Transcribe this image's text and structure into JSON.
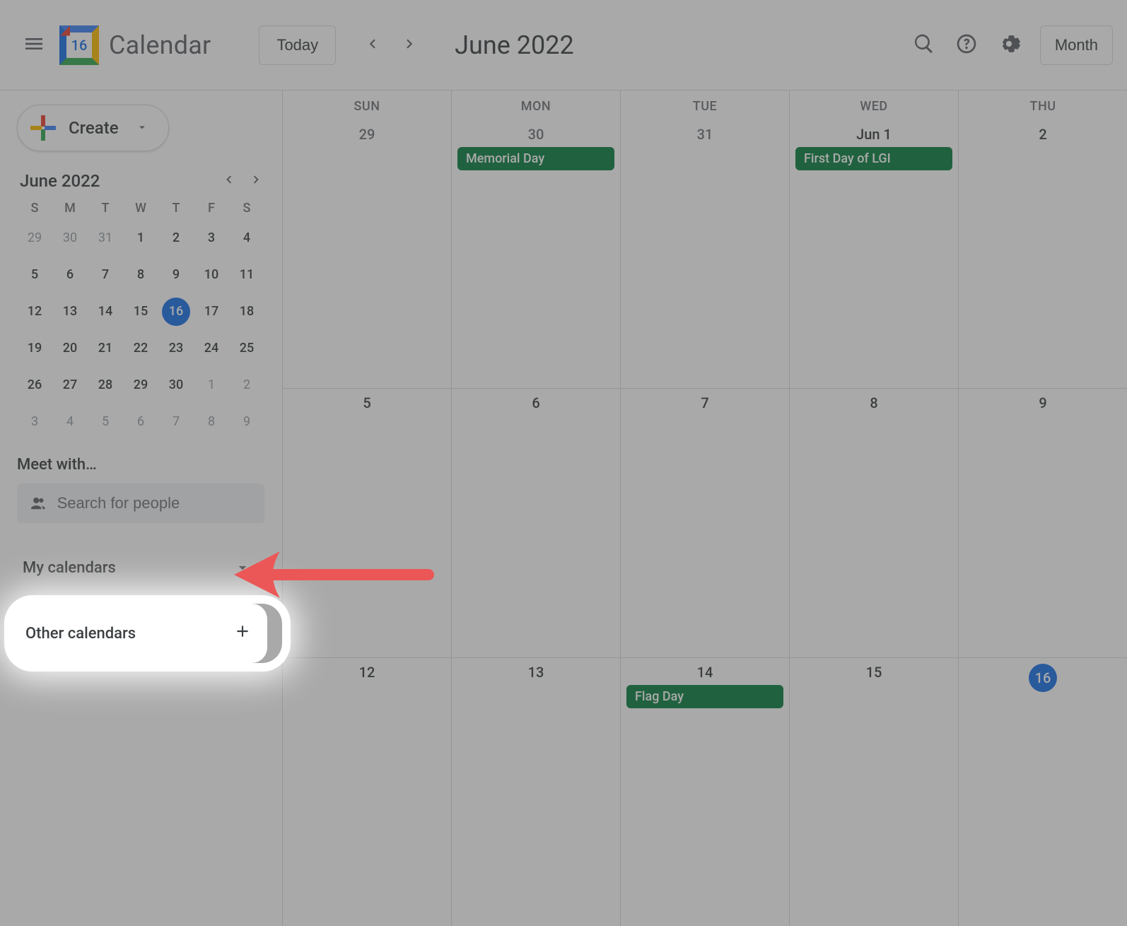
{
  "header": {
    "logo_day": "16",
    "app_name": "Calendar",
    "today_label": "Today",
    "title": "June 2022",
    "view_label": "Month"
  },
  "create": {
    "label": "Create"
  },
  "mini": {
    "title": "June 2022",
    "dow": [
      "S",
      "M",
      "T",
      "W",
      "T",
      "F",
      "S"
    ],
    "rows": [
      [
        {
          "d": "29",
          "t": "prev"
        },
        {
          "d": "30",
          "t": "prev"
        },
        {
          "d": "31",
          "t": "prev"
        },
        {
          "d": "1"
        },
        {
          "d": "2"
        },
        {
          "d": "3"
        },
        {
          "d": "4"
        }
      ],
      [
        {
          "d": "5"
        },
        {
          "d": "6"
        },
        {
          "d": "7"
        },
        {
          "d": "8"
        },
        {
          "d": "9"
        },
        {
          "d": "10"
        },
        {
          "d": "11"
        }
      ],
      [
        {
          "d": "12"
        },
        {
          "d": "13"
        },
        {
          "d": "14"
        },
        {
          "d": "15"
        },
        {
          "d": "16",
          "t": "today"
        },
        {
          "d": "17"
        },
        {
          "d": "18"
        }
      ],
      [
        {
          "d": "19"
        },
        {
          "d": "20"
        },
        {
          "d": "21"
        },
        {
          "d": "22"
        },
        {
          "d": "23"
        },
        {
          "d": "24"
        },
        {
          "d": "25"
        }
      ],
      [
        {
          "d": "26"
        },
        {
          "d": "27"
        },
        {
          "d": "28"
        },
        {
          "d": "29"
        },
        {
          "d": "30"
        },
        {
          "d": "1",
          "t": "next"
        },
        {
          "d": "2",
          "t": "next"
        }
      ],
      [
        {
          "d": "3",
          "t": "next"
        },
        {
          "d": "4",
          "t": "next"
        },
        {
          "d": "5",
          "t": "next"
        },
        {
          "d": "6",
          "t": "next"
        },
        {
          "d": "7",
          "t": "next"
        },
        {
          "d": "8",
          "t": "next"
        },
        {
          "d": "9",
          "t": "next"
        }
      ]
    ]
  },
  "meet": {
    "label": "Meet with…",
    "placeholder": "Search for people"
  },
  "groups": {
    "my": "My calendars",
    "other": "Other calendars"
  },
  "grid": {
    "dow": [
      "SUN",
      "MON",
      "TUE",
      "WED",
      "THU"
    ],
    "weeks": [
      [
        {
          "label": "29",
          "cur": false
        },
        {
          "label": "30",
          "cur": false,
          "events": [
            "Memorial Day"
          ]
        },
        {
          "label": "31",
          "cur": false
        },
        {
          "label": "Jun 1",
          "cur": true,
          "events": [
            "First Day of LGI"
          ]
        },
        {
          "label": "2",
          "cur": true
        }
      ],
      [
        {
          "label": "5",
          "cur": true
        },
        {
          "label": "6",
          "cur": true
        },
        {
          "label": "7",
          "cur": true
        },
        {
          "label": "8",
          "cur": true
        },
        {
          "label": "9",
          "cur": true
        }
      ],
      [
        {
          "label": "12",
          "cur": true
        },
        {
          "label": "13",
          "cur": true
        },
        {
          "label": "14",
          "cur": true,
          "events": [
            "Flag Day"
          ]
        },
        {
          "label": "15",
          "cur": true
        },
        {
          "label": "16",
          "cur": true,
          "today": true
        }
      ]
    ]
  }
}
